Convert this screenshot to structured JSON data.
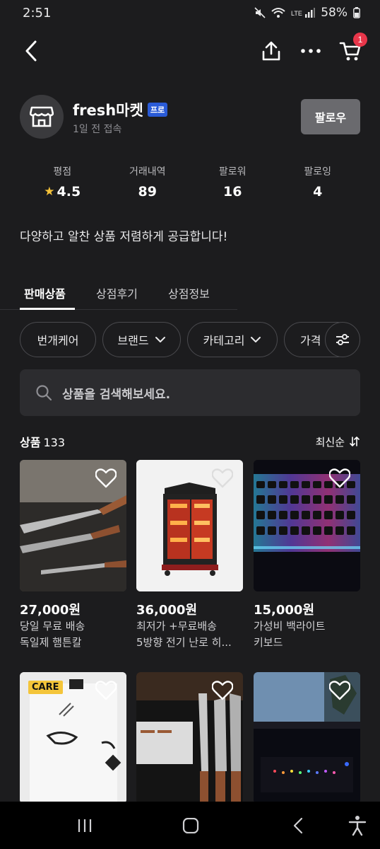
{
  "status": {
    "time": "2:51",
    "battery": "58%"
  },
  "store": {
    "name": "fresh마켓",
    "badge": "프로",
    "last_seen": "1일 전 접속",
    "follow_label": "팔로우"
  },
  "cart": {
    "badge_count": "1"
  },
  "stats": [
    {
      "label": "평점",
      "value": "4.5"
    },
    {
      "label": "거래내역",
      "value": "89"
    },
    {
      "label": "팔로워",
      "value": "16"
    },
    {
      "label": "팔로잉",
      "value": "4"
    }
  ],
  "description": "다양하고 알찬 상품 저렴하게 공급합니다!",
  "tabs": [
    {
      "label": "판매상품"
    },
    {
      "label": "상점후기"
    },
    {
      "label": "상점정보"
    }
  ],
  "filters": [
    {
      "label": "번개케어"
    },
    {
      "label": "브랜드"
    },
    {
      "label": "카테고리"
    },
    {
      "label": "가격"
    }
  ],
  "search": {
    "placeholder": "상품을 검색해보세요."
  },
  "list": {
    "count_label": "상품",
    "count": "133",
    "sort_label": "최신순"
  },
  "products": [
    {
      "price": "27,000원",
      "line1": "당일 무료 배송",
      "line2": "독일제 햄튼칼"
    },
    {
      "price": "36,000원",
      "line1": "최저가 +무료배송",
      "line2": "5방향 전기 난로 히..."
    },
    {
      "price": "15,000원",
      "line1": "가성비 백라이트",
      "line2": "키보드"
    },
    {
      "badge": "CARE"
    },
    {},
    {}
  ],
  "colors": {
    "background": "#1c1c1e",
    "accent_badge": "#e8364a",
    "pro_badge": "#2a5bd7",
    "star": "#f6c33a"
  }
}
